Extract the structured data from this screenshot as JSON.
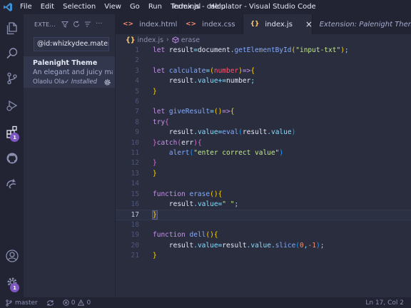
{
  "window": {
    "title": "index.js - calculator - Visual Studio Code"
  },
  "menu": [
    "File",
    "Edit",
    "Selection",
    "View",
    "Go",
    "Run",
    "Terminal",
    "Help"
  ],
  "activity": {
    "extensions_badge": "1",
    "settings_badge": "1",
    "icons": [
      "files-icon",
      "search-icon",
      "source-control-icon",
      "run-debug-icon",
      "extensions-icon",
      "github-icon",
      "remote-icon",
      "account-icon",
      "settings-gear-icon"
    ]
  },
  "sidebar": {
    "title": "EXTE...",
    "search_value": "@id:whizkydee.material-palenight-theme",
    "extension": {
      "name": "Palenight Theme",
      "description": "An elegant and juicy material-like theme",
      "publisher": "Olaolu Olawuyi",
      "status": "✓ Installed"
    }
  },
  "tabs": [
    {
      "icon": "<>",
      "label": "index.html",
      "active": false,
      "color": "#f78c6c"
    },
    {
      "icon": "<>",
      "label": "index.css",
      "active": false,
      "color": "#f78c6c"
    },
    {
      "icon": "{}",
      "label": "index.js",
      "active": true,
      "color": "#ffcb6b"
    },
    {
      "icon": "",
      "label": "Extension: Palenight Theme",
      "active": false,
      "color": "#a6accd"
    }
  ],
  "breadcrumb": {
    "file_icon": "{}",
    "file": "index.js",
    "symbol": "erase"
  },
  "editor": {
    "line_numbers": [
      "1",
      "2",
      "3",
      "4",
      "5",
      "6",
      "7",
      "8",
      "9",
      "10",
      "11",
      "12",
      "13",
      "14",
      "15",
      "16",
      "17",
      "18",
      "19",
      "20",
      "21"
    ],
    "current_line": 17,
    "tokens": {
      "l1": [
        "let",
        " result",
        "=",
        "document",
        ".",
        "getElementById",
        "(",
        "\"input-txt\"",
        ")",
        ";"
      ],
      "l3": [
        "let",
        " calculate",
        "=",
        "(",
        "number",
        ")",
        "=>",
        "{"
      ],
      "l4": [
        "    result",
        ".",
        "value",
        "+=",
        "number",
        ";"
      ],
      "l5": [
        "}"
      ],
      "l7": [
        "let",
        " giveResult",
        "=",
        "(",
        ")",
        "=>",
        "{"
      ],
      "l8": [
        "try",
        "{"
      ],
      "l9": [
        "    result",
        ".",
        "value",
        "=",
        "eval",
        "(",
        "result",
        ".",
        "value",
        ")"
      ],
      "l10": [
        "}",
        "catch",
        "(",
        "err",
        ")",
        "{"
      ],
      "l11": [
        "    alert",
        "(",
        "\"enter correct value\"",
        ")"
      ],
      "l12": [
        "}"
      ],
      "l13": [
        "}"
      ],
      "l15": [
        "function",
        " erase",
        "(",
        ")",
        "{"
      ],
      "l16": [
        "    result",
        ".",
        "value",
        "=",
        "\" \"",
        ";"
      ],
      "l17": [
        "}"
      ],
      "l19": [
        "function",
        " dell",
        "(",
        ")",
        "{"
      ],
      "l20": [
        "    result",
        ".",
        "value",
        "=",
        "result",
        ".",
        "value",
        ".",
        "slice",
        "(",
        "0",
        ",",
        "-1",
        ")",
        ";"
      ],
      "l21": [
        "}"
      ]
    }
  },
  "status": {
    "branch": "master",
    "errors": "0",
    "warnings": "0",
    "position": "Ln 17, Col 2"
  }
}
